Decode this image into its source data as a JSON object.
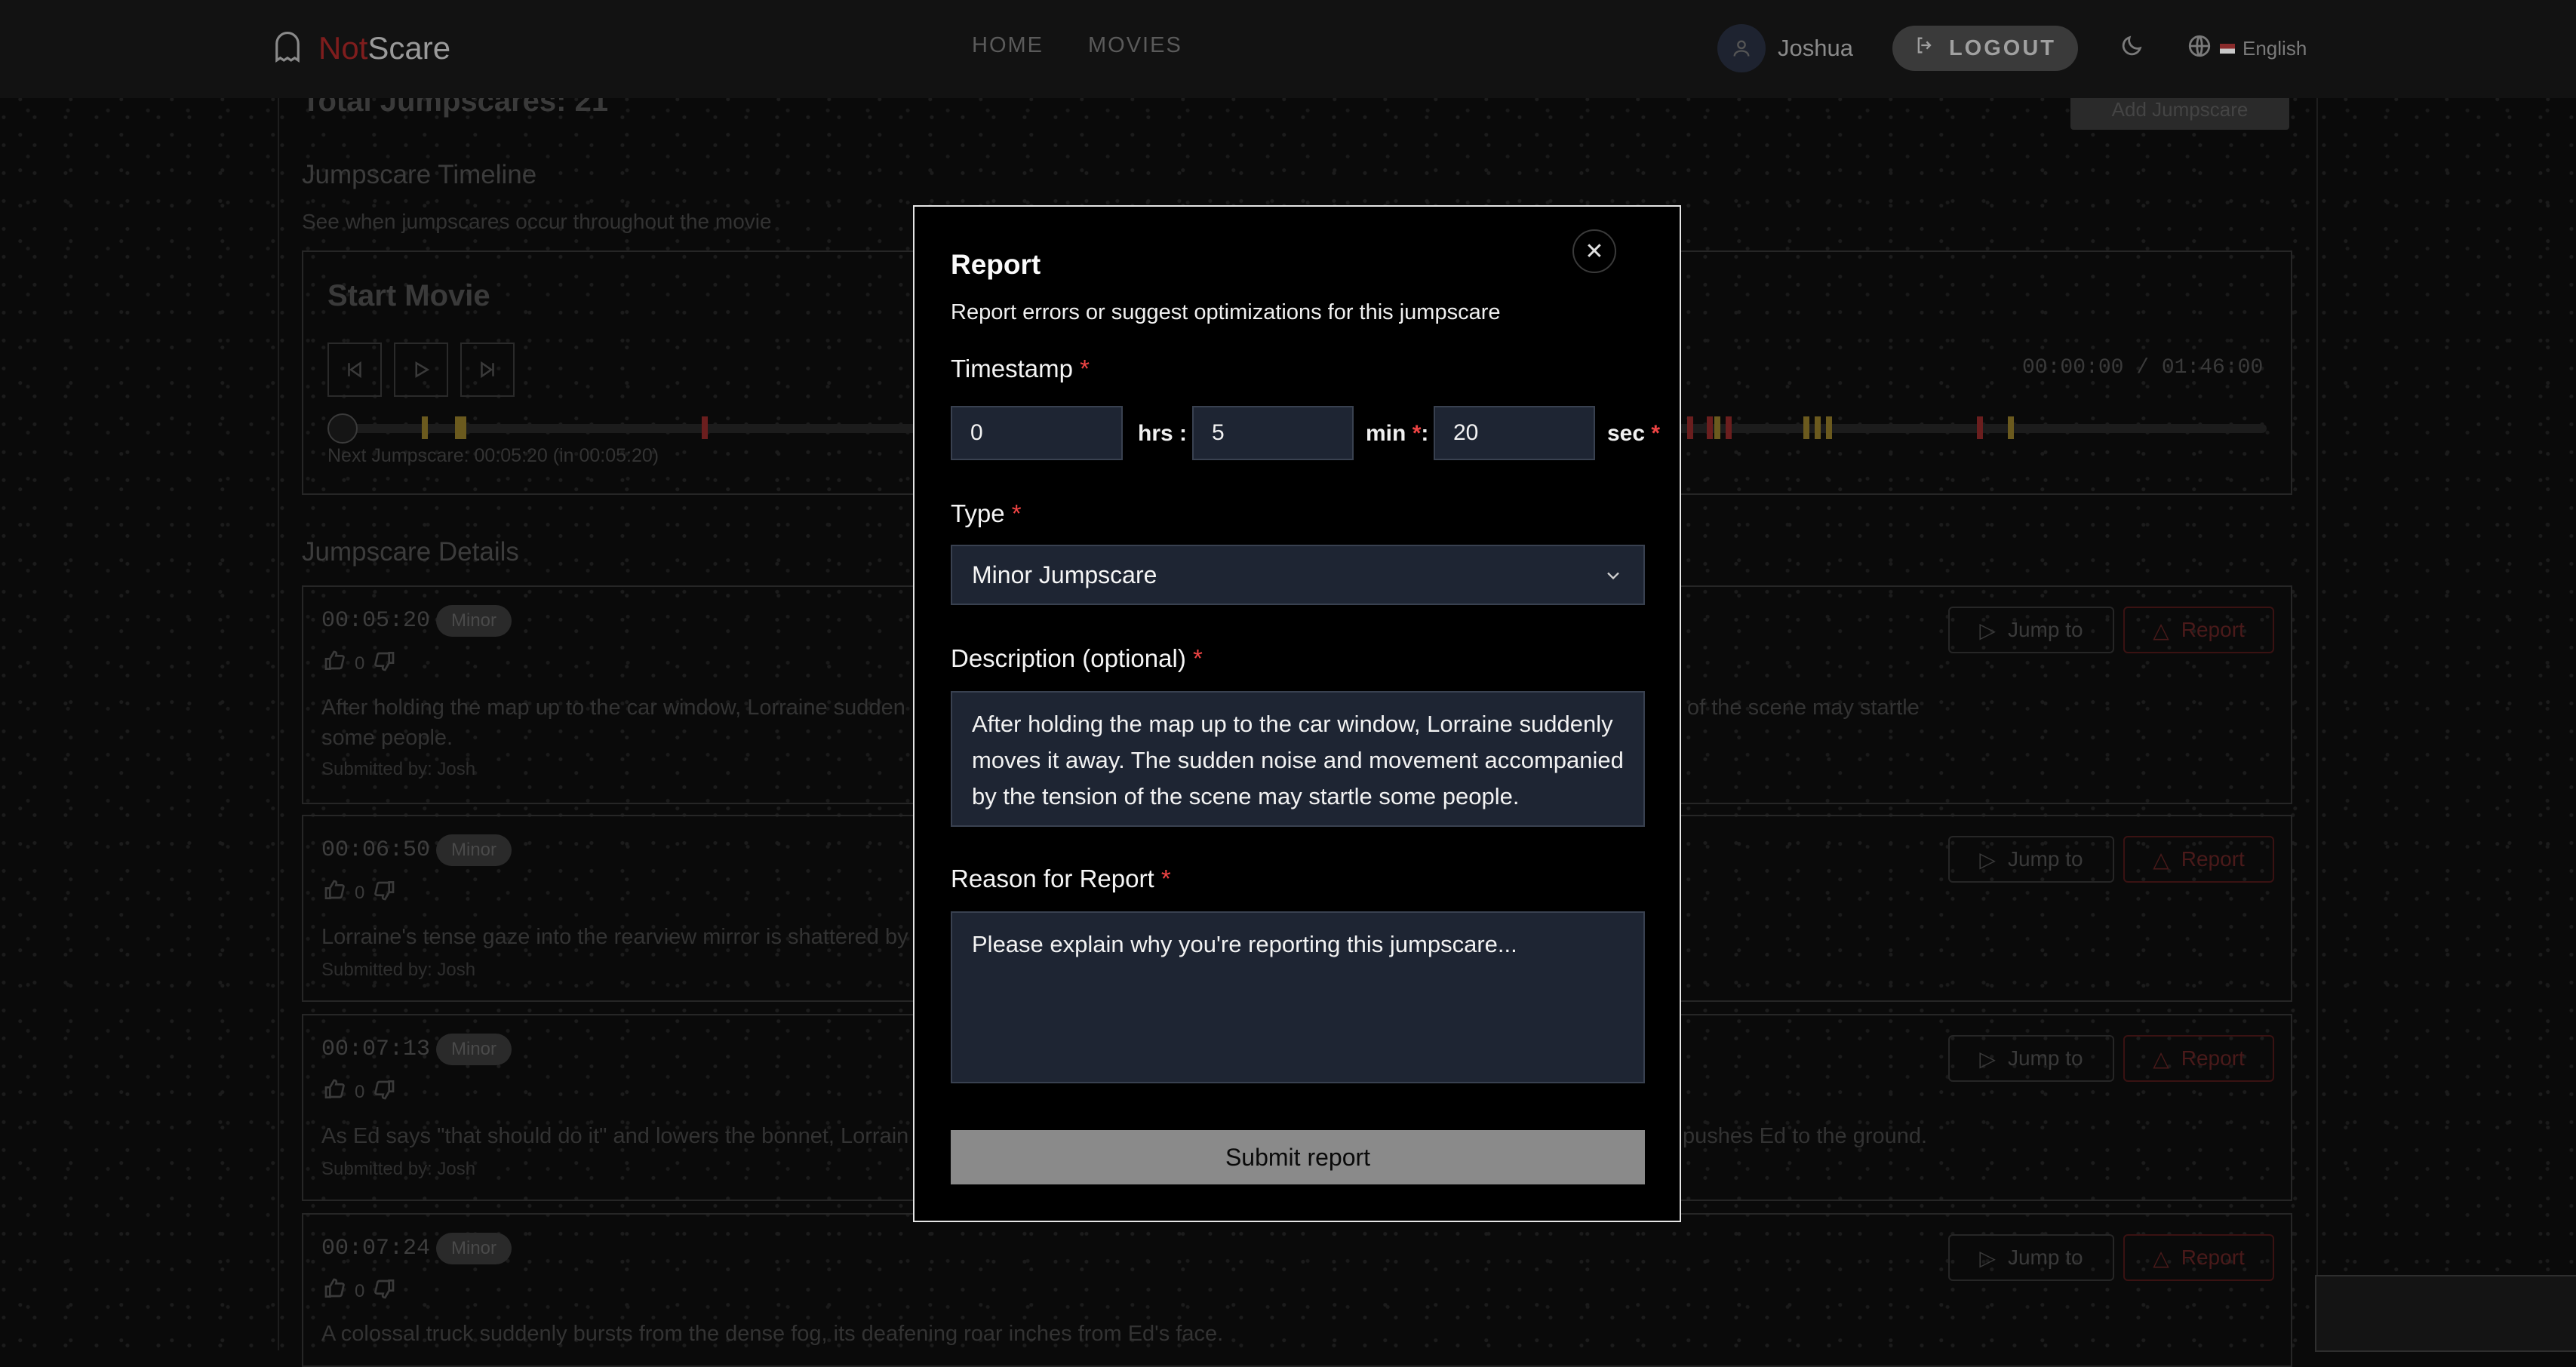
{
  "header": {
    "logo_not": "Not",
    "logo_scare": "Scare",
    "nav": [
      "HOME",
      "MOVIES"
    ],
    "user_name": "Joshua",
    "logout_label": "LOGOUT",
    "language": "English"
  },
  "page": {
    "total_jumpscares": "Total Jumpscares: 21",
    "add_jumpscare": "Add Jumpscare",
    "timeline_title": "Jumpscare Timeline",
    "timeline_subtitle": "See when jumpscares occur throughout the movie",
    "start_movie": "Start Movie",
    "time_display": "00:00:00 / 01:46:00",
    "next_jumpscare": "Next Jumpscare: 00:05:20  (in 00:05:20)",
    "details_title": "Jumpscare Details",
    "jump_label": "Jump to",
    "report_label": "Report",
    "cards": [
      {
        "time": "00:05:20",
        "badge": "Minor",
        "votes_up": "0",
        "desc": "After holding the map up to the car window, Lorraine sudden",
        "desc_right": "of the scene may startle",
        "desc2": "some people.",
        "submitted": "Submitted by: Josh"
      },
      {
        "time": "00:06:50",
        "badge": "Minor",
        "votes_up": "0",
        "desc": "Lorraine's tense gaze into the rearview mirror is shattered by",
        "submitted": "Submitted by: Josh"
      },
      {
        "time": "00:07:13",
        "badge": "Minor",
        "votes_up": "0",
        "desc": "As Ed says \"that should do it\" and lowers the bonnet, Lorrain",
        "desc_right": "pushes Ed to the ground.",
        "submitted": "Submitted by: Josh"
      },
      {
        "time": "00:07:24",
        "badge": "Minor",
        "votes_up": "0",
        "desc": "A colossal truck suddenly bursts from the dense fog, its deafening roar inches from Ed's face."
      }
    ]
  },
  "timeline_marks": [
    {
      "pos": 0.045,
      "color": "#6b5a1e"
    },
    {
      "pos": 0.062,
      "color": "#6b5a1e"
    },
    {
      "pos": 0.065,
      "color": "#6b5a1e"
    },
    {
      "pos": 0.19,
      "color": "#6b1e1e"
    },
    {
      "pos": 0.7,
      "color": "#6b1e1e"
    },
    {
      "pos": 0.71,
      "color": "#6b1e1e"
    },
    {
      "pos": 0.714,
      "color": "#6b5a1e"
    },
    {
      "pos": 0.72,
      "color": "#6b1e1e"
    },
    {
      "pos": 0.76,
      "color": "#6b5a1e"
    },
    {
      "pos": 0.766,
      "color": "#6b5a1e"
    },
    {
      "pos": 0.772,
      "color": "#6b5a1e"
    },
    {
      "pos": 0.85,
      "color": "#6b1e1e"
    },
    {
      "pos": 0.866,
      "color": "#6b5a1e"
    }
  ],
  "modal": {
    "title": "Report",
    "subtitle": "Report errors or suggest optimizations for this jumpscare",
    "timestamp_label": "Timestamp",
    "hours_value": "0",
    "hours_unit": "hrs :",
    "minutes_value": "5",
    "minutes_unit": "min",
    "seconds_value": "20",
    "seconds_unit": "sec",
    "type_label": "Type",
    "type_value": "Minor Jumpscare",
    "description_label": "Description (optional)",
    "description_value": "After holding the map up to the car window, Lorraine suddenly moves it away. The sudden noise and movement accompanied by the tension of the scene may startle some people.",
    "reason_label": "Reason for Report",
    "reason_placeholder": "Please explain why you're reporting this jumpscare...",
    "submit_label": "Submit report"
  }
}
